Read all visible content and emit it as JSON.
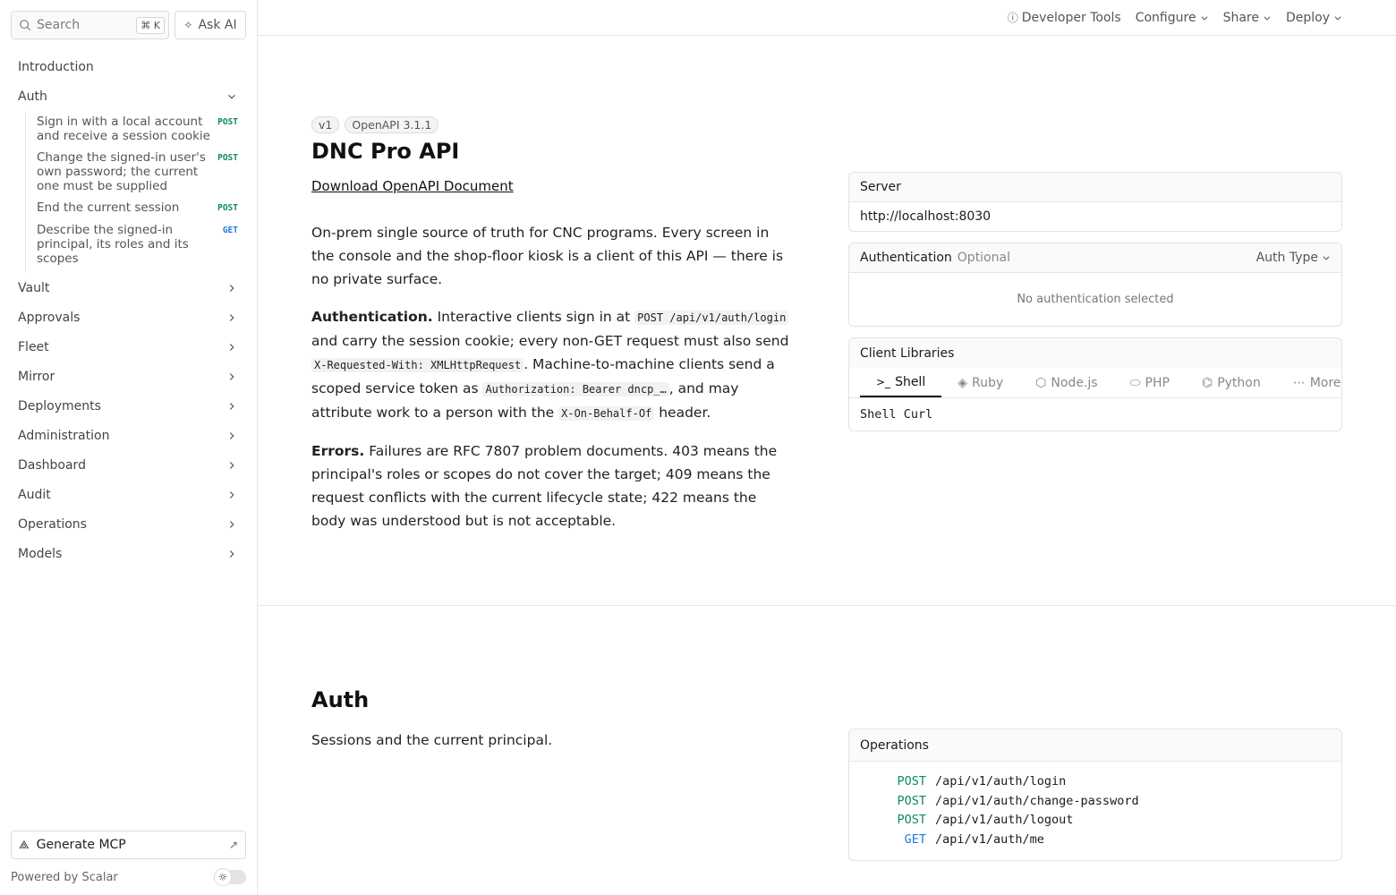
{
  "sidebar": {
    "search_label": "Search",
    "search_shortcut": "⌘ K",
    "ask_ai_label": "Ask AI",
    "items": [
      {
        "label": "Introduction"
      },
      {
        "label": "Auth"
      },
      {
        "label": "Vault"
      },
      {
        "label": "Approvals"
      },
      {
        "label": "Fleet"
      },
      {
        "label": "Mirror"
      },
      {
        "label": "Deployments"
      },
      {
        "label": "Administration"
      },
      {
        "label": "Dashboard"
      },
      {
        "label": "Audit"
      },
      {
        "label": "Operations"
      },
      {
        "label": "Models"
      }
    ],
    "auth_children": [
      {
        "label": "Sign in with a local account and receive a session cookie",
        "method": "POST"
      },
      {
        "label": "Change the signed-in user's own password; the current one must be supplied",
        "method": "POST"
      },
      {
        "label": "End the current session",
        "method": "POST"
      },
      {
        "label": "Describe the signed-in principal, its roles and its scopes",
        "method": "GET"
      }
    ],
    "generate_mcp_label": "Generate MCP",
    "powered_by": "Powered by Scalar"
  },
  "topbar": {
    "developer_tools": "Developer Tools",
    "configure": "Configure",
    "share": "Share",
    "deploy": "Deploy"
  },
  "intro": {
    "version_badge": "v1",
    "openapi_badge": "OpenAPI 3.1.1",
    "title": "DNC Pro API",
    "download_link": "Download OpenAPI Document",
    "p1": "On-prem single source of truth for CNC programs. Every screen in the console and the shop-floor kiosk is a client of this API — there is no private surface.",
    "auth_heading": "Authentication.",
    "auth_t1": " Interactive clients sign in at ",
    "auth_c1": "POST /api/v1/auth/login",
    "auth_t2": " and carry the session cookie; every non-GET request must also send ",
    "auth_c2": "X-Requested-With: XMLHttpRequest",
    "auth_t3": ". Machine-to-machine clients send a scoped service token as ",
    "auth_c3": "Authorization: Bearer dncp_…",
    "auth_t4": ", and may attribute work to a person with the ",
    "auth_c4": "X-On-Behalf-Of",
    "auth_t5": " header.",
    "errors_heading": "Errors.",
    "errors_text": " Failures are RFC 7807 problem documents. 403 means the principal's roles or scopes do not cover the target; 409 means the request conflicts with the current lifecycle state; 422 means the body was understood but is not acceptable."
  },
  "server_card": {
    "title": "Server",
    "url": "http://localhost:8030"
  },
  "auth_card": {
    "title": "Authentication",
    "optional": "Optional",
    "auth_type": "Auth Type",
    "empty": "No authentication selected"
  },
  "client_card": {
    "title": "Client Libraries",
    "tabs": [
      {
        "label": "Shell",
        "icon": "terminal-icon"
      },
      {
        "label": "Ruby",
        "icon": "ruby-icon"
      },
      {
        "label": "Node.js",
        "icon": "nodejs-icon"
      },
      {
        "label": "PHP",
        "icon": "php-icon"
      },
      {
        "label": "Python",
        "icon": "python-icon"
      },
      {
        "label": "More",
        "icon": "more-icon"
      }
    ],
    "selected": "Shell Curl"
  },
  "auth_section": {
    "title": "Auth",
    "description": "Sessions and the current principal.",
    "ops_title": "Operations",
    "ops": [
      {
        "method": "POST",
        "path": "/api/v1/auth/login"
      },
      {
        "method": "POST",
        "path": "/api/v1/auth/change-password"
      },
      {
        "method": "POST",
        "path": "/api/v1/auth/logout"
      },
      {
        "method": "GET",
        "path": "/api/v1/auth/me"
      }
    ]
  },
  "colors": {
    "post": "#0f8a5f",
    "get": "#1f7bd6"
  }
}
